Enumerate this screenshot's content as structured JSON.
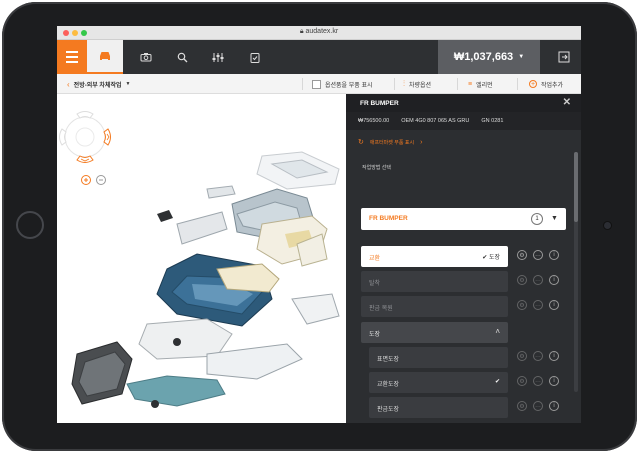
{
  "browser": {
    "url": "audatex.kr"
  },
  "nav": {
    "tabs": [
      {
        "icon": "car-front-icon",
        "active": true
      },
      {
        "icon": "camera-icon",
        "active": false
      },
      {
        "icon": "search-icon",
        "active": false
      },
      {
        "icon": "sliders-icon",
        "active": false
      },
      {
        "icon": "checklist-icon",
        "active": false
      }
    ],
    "total_price": "₩1,037,663",
    "colors": {
      "accent": "#f47a20",
      "nav_bg": "#2e3033"
    }
  },
  "toolbar": {
    "breadcrumb": "전방-외부 차체작업",
    "show_option_parts": "옵션품을 부품 표시",
    "vehicle_options": "차량옵션",
    "memo": "엘리먼",
    "add_work": "작업추가"
  },
  "panel": {
    "title": "FR BUMPER",
    "price": "₩756500.00",
    "oem": "OEM 4G0 807 065 AS GRU",
    "gn": "GN 0281",
    "aftermarket_link": "애프터마켓 부품 표시",
    "method_label": "작업방법 선택",
    "dropdown_value": "FR BUMPER",
    "dropdown_count": "1",
    "rows": [
      {
        "label": "교환",
        "check": "✔ 도장",
        "active": true
      },
      {
        "label": "탈착",
        "check": "",
        "active": false
      },
      {
        "label": "판금 복원",
        "check": "",
        "active": false
      }
    ],
    "paint_group": "도장",
    "paint_rows": [
      {
        "label": "표면도장",
        "check": ""
      },
      {
        "label": "교환도장",
        "check": "✔"
      },
      {
        "label": "판금도장",
        "check": ""
      }
    ]
  }
}
